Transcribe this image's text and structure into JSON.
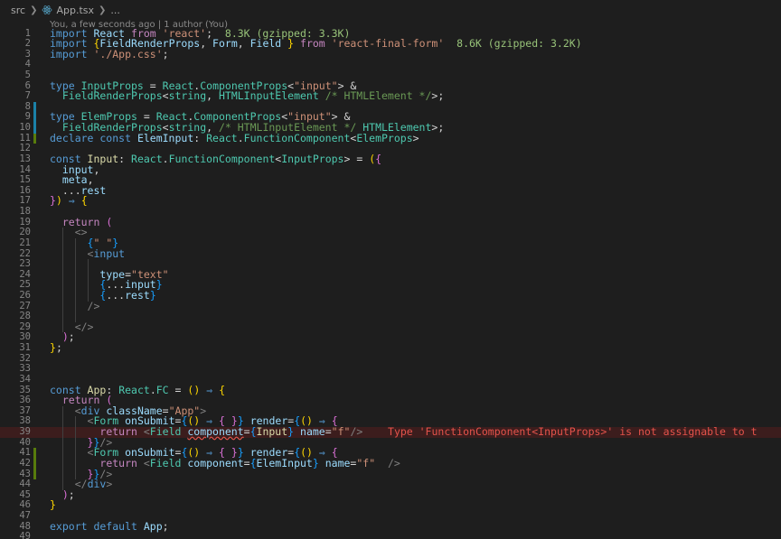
{
  "breadcrumb": {
    "folder": "src",
    "file": "App.tsx",
    "tail": "..."
  },
  "blame": "You, a few seconds ago | 1 author (You)",
  "import_sizes": {
    "react": "8.3K (gzipped: 3.3K)",
    "final_form": "8.6K (gzipped: 3.2K)"
  },
  "error_message": "Type 'FunctionComponent<InputProps>' is not assignable to t",
  "lines": [
    {
      "n": "1"
    },
    {
      "n": "2"
    },
    {
      "n": "3"
    },
    {
      "n": "4"
    },
    {
      "n": "5"
    },
    {
      "n": "6"
    },
    {
      "n": "7"
    },
    {
      "n": "8"
    },
    {
      "n": "9"
    },
    {
      "n": "10"
    },
    {
      "n": "11"
    },
    {
      "n": "12"
    },
    {
      "n": "13"
    },
    {
      "n": "14"
    },
    {
      "n": "15"
    },
    {
      "n": "16"
    },
    {
      "n": "17"
    },
    {
      "n": "18"
    },
    {
      "n": "19"
    },
    {
      "n": "20"
    },
    {
      "n": "21"
    },
    {
      "n": "22"
    },
    {
      "n": "23"
    },
    {
      "n": "24"
    },
    {
      "n": "25"
    },
    {
      "n": "26"
    },
    {
      "n": "27"
    },
    {
      "n": "28"
    },
    {
      "n": "29"
    },
    {
      "n": "30"
    },
    {
      "n": "31"
    },
    {
      "n": "32"
    },
    {
      "n": "33"
    },
    {
      "n": "34"
    },
    {
      "n": "35"
    },
    {
      "n": "36"
    },
    {
      "n": "37"
    },
    {
      "n": "38"
    },
    {
      "n": "39"
    },
    {
      "n": "40"
    },
    {
      "n": "41"
    },
    {
      "n": "42"
    },
    {
      "n": "43"
    },
    {
      "n": "44"
    },
    {
      "n": "45"
    },
    {
      "n": "46"
    },
    {
      "n": "47"
    },
    {
      "n": "48"
    },
    {
      "n": "49"
    }
  ],
  "tokens": {
    "l1": [
      [
        "k",
        "import "
      ],
      [
        "v",
        "React "
      ],
      [
        "kc",
        "from "
      ],
      [
        "s",
        "'react'"
      ],
      [
        "p",
        ";  "
      ]
    ],
    "l2": [
      [
        "k",
        "import "
      ],
      [
        "b1",
        "{"
      ],
      [
        "v",
        "FieldRenderProps"
      ],
      [
        "p",
        ", "
      ],
      [
        "v",
        "Form"
      ],
      [
        "p",
        ", "
      ],
      [
        "v",
        "Field "
      ],
      [
        "b1",
        "}"
      ],
      [
        "p",
        " "
      ],
      [
        "kc",
        "from "
      ],
      [
        "s",
        "'react-final-form'"
      ],
      [
        "p",
        "  "
      ]
    ],
    "l3": [
      [
        "k",
        "import "
      ],
      [
        "s",
        "'./App.css'"
      ],
      [
        "p",
        ";"
      ]
    ],
    "l6": [
      [
        "k",
        "type "
      ],
      [
        "t",
        "InputProps "
      ],
      [
        "p",
        "= "
      ],
      [
        "t",
        "React"
      ],
      [
        "p",
        "."
      ],
      [
        "t",
        "ComponentProps"
      ],
      [
        "p",
        "<"
      ],
      [
        "s",
        "\"input\""
      ],
      [
        "p",
        "> &"
      ]
    ],
    "l7": [
      [
        "p",
        "  "
      ],
      [
        "t",
        "FieldRenderProps"
      ],
      [
        "p",
        "<"
      ],
      [
        "t",
        "string"
      ],
      [
        "p",
        ", "
      ],
      [
        "t",
        "HTMLInputElement "
      ],
      [
        "c",
        "/* HTMLElement */"
      ],
      [
        "p",
        ">;"
      ]
    ],
    "l9": [
      [
        "k",
        "type "
      ],
      [
        "t",
        "ElemProps "
      ],
      [
        "p",
        "= "
      ],
      [
        "t",
        "React"
      ],
      [
        "p",
        "."
      ],
      [
        "t",
        "ComponentProps"
      ],
      [
        "p",
        "<"
      ],
      [
        "s",
        "\"input\""
      ],
      [
        "p",
        "> &"
      ]
    ],
    "l10": [
      [
        "p",
        "  "
      ],
      [
        "t",
        "FieldRenderProps"
      ],
      [
        "p",
        "<"
      ],
      [
        "t",
        "string"
      ],
      [
        "p",
        ", "
      ],
      [
        "c",
        "/* HTMLInputElement */ "
      ],
      [
        "t",
        "HTMLElement"
      ],
      [
        "p",
        ">;"
      ]
    ],
    "l11": [
      [
        "k",
        "declare const "
      ],
      [
        "v",
        "ElemInput"
      ],
      [
        "p",
        ": "
      ],
      [
        "t",
        "React"
      ],
      [
        "p",
        "."
      ],
      [
        "t",
        "FunctionComponent"
      ],
      [
        "p",
        "<"
      ],
      [
        "t",
        "ElemProps"
      ],
      [
        "p",
        ">"
      ]
    ],
    "l13": [
      [
        "k",
        "const "
      ],
      [
        "f",
        "Input"
      ],
      [
        "p",
        ": "
      ],
      [
        "t",
        "React"
      ],
      [
        "p",
        "."
      ],
      [
        "t",
        "FunctionComponent"
      ],
      [
        "p",
        "<"
      ],
      [
        "t",
        "InputProps"
      ],
      [
        "p",
        "> = "
      ],
      [
        "b1",
        "("
      ],
      [
        "b2",
        "{"
      ]
    ],
    "l14": [
      [
        "p",
        "  "
      ],
      [
        "v",
        "input"
      ],
      [
        "p",
        ","
      ]
    ],
    "l15": [
      [
        "p",
        "  "
      ],
      [
        "v",
        "meta"
      ],
      [
        "p",
        ","
      ]
    ],
    "l16": [
      [
        "p",
        "  ..."
      ],
      [
        "v",
        "rest"
      ]
    ],
    "l17": [
      [
        "b2",
        "}"
      ],
      [
        "b1",
        ")"
      ],
      [
        "p",
        " "
      ],
      [
        "k",
        "⇒"
      ],
      [
        "p",
        " "
      ],
      [
        "b1",
        "{"
      ]
    ],
    "l19": [
      [
        "p",
        "  "
      ],
      [
        "kc",
        "return "
      ],
      [
        "b2",
        "("
      ]
    ],
    "l20": [
      [
        "p",
        "    "
      ],
      [
        "tag",
        "<>"
      ]
    ],
    "l21": [
      [
        "p",
        "      "
      ],
      [
        "b3",
        "{"
      ],
      [
        "s",
        "\" \""
      ],
      [
        "b3",
        "}"
      ]
    ],
    "l22": [
      [
        "p",
        "      "
      ],
      [
        "tag",
        "<"
      ],
      [
        "jsx",
        "input"
      ]
    ],
    "l24": [
      [
        "p",
        "        "
      ],
      [
        "v",
        "type"
      ],
      [
        "p",
        "="
      ],
      [
        "s",
        "\"text\""
      ]
    ],
    "l25": [
      [
        "p",
        "        "
      ],
      [
        "b3",
        "{"
      ],
      [
        "p",
        "..."
      ],
      [
        "v",
        "input"
      ],
      [
        "b3",
        "}"
      ]
    ],
    "l26": [
      [
        "p",
        "        "
      ],
      [
        "b3",
        "{"
      ],
      [
        "p",
        "..."
      ],
      [
        "v",
        "rest"
      ],
      [
        "b3",
        "}"
      ]
    ],
    "l27": [
      [
        "p",
        "      "
      ],
      [
        "tag",
        "/>"
      ]
    ],
    "l29": [
      [
        "p",
        "    "
      ],
      [
        "tag",
        "</>"
      ]
    ],
    "l30": [
      [
        "p",
        "  "
      ],
      [
        "b2",
        ")"
      ],
      [
        "p",
        ";"
      ]
    ],
    "l31": [
      [
        "b1",
        "}"
      ],
      [
        "p",
        ";"
      ]
    ],
    "l35": [
      [
        "k",
        "const "
      ],
      [
        "f",
        "App"
      ],
      [
        "p",
        ": "
      ],
      [
        "t",
        "React"
      ],
      [
        "p",
        "."
      ],
      [
        "t",
        "FC"
      ],
      [
        "p",
        " = "
      ],
      [
        "b1",
        "()"
      ],
      [
        "p",
        " "
      ],
      [
        "k",
        "⇒"
      ],
      [
        "p",
        " "
      ],
      [
        "b1",
        "{"
      ]
    ],
    "l36": [
      [
        "p",
        "  "
      ],
      [
        "kc",
        "return "
      ],
      [
        "b2",
        "("
      ]
    ],
    "l37": [
      [
        "p",
        "    "
      ],
      [
        "tag",
        "<"
      ],
      [
        "jsx",
        "div "
      ],
      [
        "v",
        "className"
      ],
      [
        "p",
        "="
      ],
      [
        "s",
        "\"App\""
      ],
      [
        "tag",
        ">"
      ]
    ],
    "l38": [
      [
        "p",
        "      "
      ],
      [
        "tag",
        "<"
      ],
      [
        "t",
        "Form "
      ],
      [
        "v",
        "onSubmit"
      ],
      [
        "p",
        "="
      ],
      [
        "b3",
        "{"
      ],
      [
        "b1",
        "()"
      ],
      [
        "p",
        " "
      ],
      [
        "k",
        "⇒"
      ],
      [
        "p",
        " "
      ],
      [
        "b2",
        "{ }"
      ],
      [
        "b3",
        "}"
      ],
      [
        "p",
        " "
      ],
      [
        "v",
        "render"
      ],
      [
        "p",
        "="
      ],
      [
        "b3",
        "{"
      ],
      [
        "b1",
        "()"
      ],
      [
        "p",
        " "
      ],
      [
        "k",
        "⇒"
      ],
      [
        "p",
        " "
      ],
      [
        "b2",
        "{"
      ]
    ],
    "l39": [
      [
        "p",
        "        "
      ],
      [
        "kc",
        "return "
      ],
      [
        "tag",
        "<"
      ],
      [
        "t",
        "Field "
      ],
      [
        "v",
        "component"
      ],
      [
        "p",
        "="
      ],
      [
        "b3",
        "{"
      ],
      [
        "f",
        "Input"
      ],
      [
        "b3",
        "}"
      ],
      [
        "p",
        " "
      ],
      [
        "v",
        "name"
      ],
      [
        "p",
        "="
      ],
      [
        "s",
        "\"f\""
      ],
      [
        "tag",
        "/>"
      ],
      [
        "p",
        "    "
      ]
    ],
    "l40": [
      [
        "p",
        "      "
      ],
      [
        "b2",
        "}"
      ],
      [
        "b3",
        "}"
      ],
      [
        "tag",
        "/>"
      ]
    ],
    "l41": [
      [
        "p",
        "      "
      ],
      [
        "tag",
        "<"
      ],
      [
        "t",
        "Form "
      ],
      [
        "v",
        "onSubmit"
      ],
      [
        "p",
        "="
      ],
      [
        "b3",
        "{"
      ],
      [
        "b1",
        "()"
      ],
      [
        "p",
        " "
      ],
      [
        "k",
        "⇒"
      ],
      [
        "p",
        " "
      ],
      [
        "b2",
        "{ }"
      ],
      [
        "b3",
        "}"
      ],
      [
        "p",
        " "
      ],
      [
        "v",
        "render"
      ],
      [
        "p",
        "="
      ],
      [
        "b3",
        "{"
      ],
      [
        "b1",
        "()"
      ],
      [
        "p",
        " "
      ],
      [
        "k",
        "⇒"
      ],
      [
        "p",
        " "
      ],
      [
        "b2",
        "{"
      ]
    ],
    "l42": [
      [
        "p",
        "        "
      ],
      [
        "kc",
        "return "
      ],
      [
        "tag",
        "<"
      ],
      [
        "t",
        "Field "
      ],
      [
        "v",
        "component"
      ],
      [
        "p",
        "="
      ],
      [
        "b3",
        "{"
      ],
      [
        "v",
        "ElemInput"
      ],
      [
        "b3",
        "}"
      ],
      [
        "p",
        " "
      ],
      [
        "v",
        "name"
      ],
      [
        "p",
        "="
      ],
      [
        "s",
        "\"f\""
      ],
      [
        "p",
        "  "
      ],
      [
        "tag",
        "/>"
      ]
    ],
    "l43": [
      [
        "p",
        "      "
      ],
      [
        "b2",
        "}"
      ],
      [
        "b3",
        "}"
      ],
      [
        "tag",
        "/>"
      ]
    ],
    "l44": [
      [
        "p",
        "    "
      ],
      [
        "tag",
        "</"
      ],
      [
        "jsx",
        "div"
      ],
      [
        "tag",
        ">"
      ]
    ],
    "l45": [
      [
        "p",
        "  "
      ],
      [
        "b2",
        ")"
      ],
      [
        "p",
        ";"
      ]
    ],
    "l46": [
      [
        "b1",
        "}"
      ]
    ],
    "l48": [
      [
        "k",
        "export default "
      ],
      [
        "v",
        "App"
      ],
      [
        "p",
        ";"
      ]
    ]
  },
  "gutter": {
    "8": "mod",
    "9": "mod",
    "10": "mod",
    "11": "added",
    "41": "added",
    "42": "added",
    "43": "added"
  }
}
